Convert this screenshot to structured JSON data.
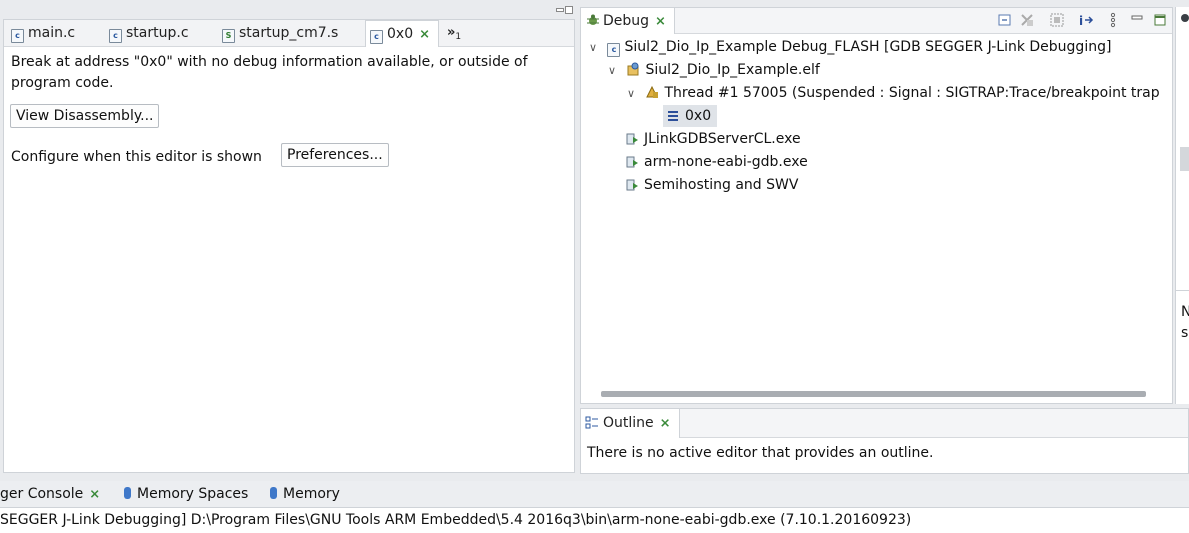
{
  "editor": {
    "tabs": [
      {
        "label": "main.c",
        "icon": "c-file-icon"
      },
      {
        "label": "startup.c",
        "icon": "c-file-icon"
      },
      {
        "label": "startup_cm7.s",
        "icon": "asm-file-icon"
      },
      {
        "label": "0x0",
        "icon": "c-file-icon",
        "active": true
      }
    ],
    "overflow_label": "»",
    "overflow_count": "1",
    "message": "Break at address \"0x0\" with no debug information available, or outside of program code.",
    "message_line1": "Break at address \"0x0\" with no debug information available, or outside of",
    "message_line2": "program code.",
    "view_disassembly_label": "View Disassembly...",
    "configure_label": "Configure when this editor is shown",
    "preferences_label": "Preferences..."
  },
  "debug": {
    "title": "Debug",
    "tree": [
      {
        "label": "Siul2_Dio_Ip_Example Debug_FLASH [GDB SEGGER J-Link Debugging]",
        "icon": "launch-config-icon",
        "expanded": true
      },
      {
        "label": "Siul2_Dio_Ip_Example.elf",
        "icon": "debug-target-icon",
        "expanded": true
      },
      {
        "label": "Thread #1 57005 (Suspended : Signal : SIGTRAP:Trace/breakpoint trap",
        "icon": "thread-suspended-icon",
        "expanded": true
      },
      {
        "label": "0x0",
        "icon": "stack-frame-icon",
        "selected": true
      },
      {
        "label": "JLinkGDBServerCL.exe",
        "icon": "process-icon"
      },
      {
        "label": "arm-none-eabi-gdb.exe",
        "icon": "process-icon"
      },
      {
        "label": "Semihosting and SWV",
        "icon": "process-icon"
      }
    ]
  },
  "outline": {
    "title": "Outline",
    "message": "There is no active editor that provides an outline."
  },
  "bottom": {
    "tabs": [
      {
        "label": "ger Console"
      },
      {
        "label": "Memory Spaces"
      },
      {
        "label": "Memory"
      }
    ],
    "console_line": "SEGGER J-Link Debugging] D:\\Program Files\\GNU Tools ARM Embedded\\5.4 2016q3\\bin\\arm-none-eabi-gdb.exe (7.10.1.20160923)"
  },
  "right_edge": {
    "char1": "N",
    "char2": "s"
  },
  "colors": {
    "accent_green": "#3a8a3a",
    "selection": "#dfe3e8",
    "panel_border": "#cfd3d8"
  }
}
